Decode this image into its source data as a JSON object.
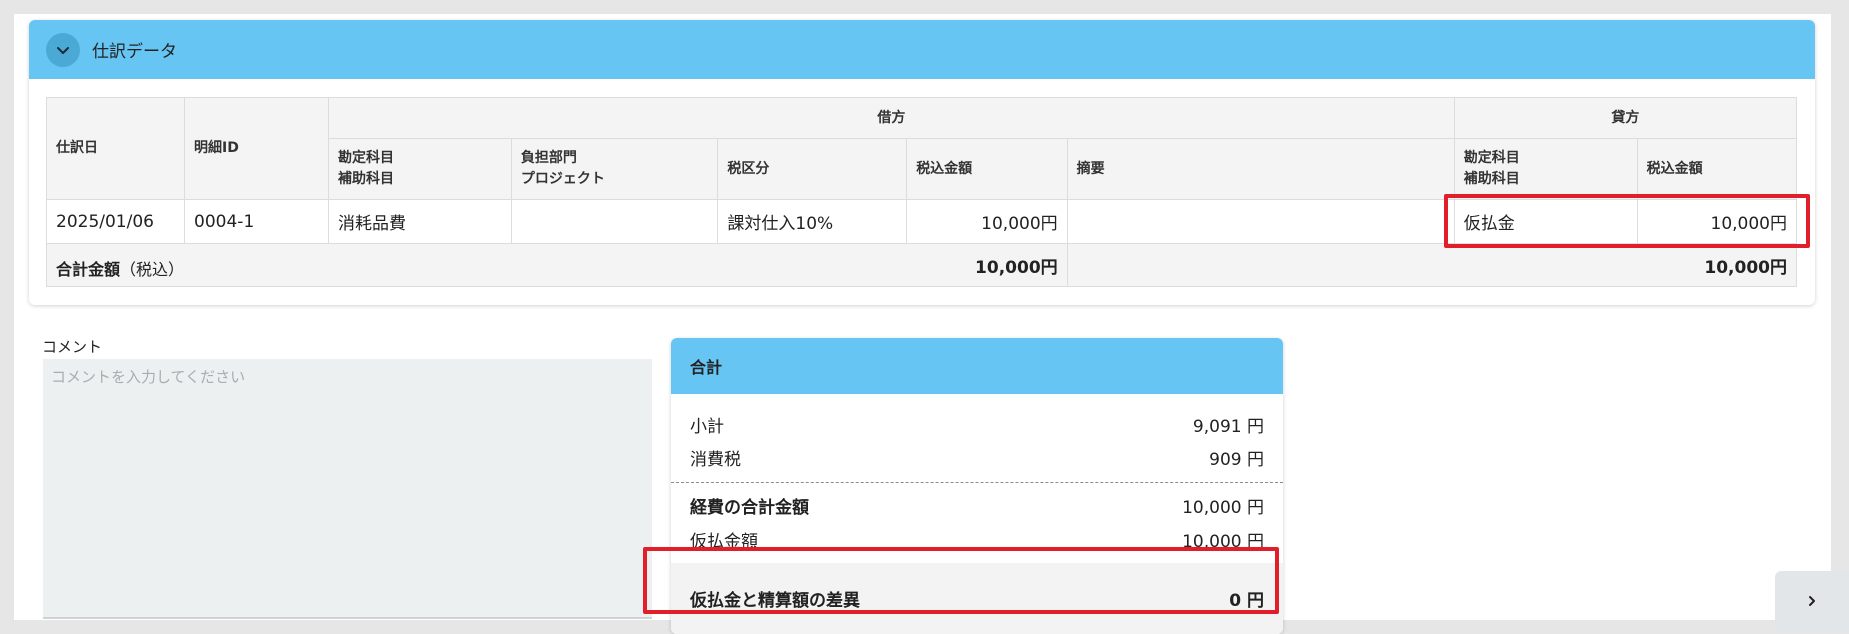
{
  "journal": {
    "title": "仕訳データ",
    "headers": {
      "date": "仕訳日",
      "detail_id": "明細ID",
      "debit": "借方",
      "credit": "貸方",
      "debit_account": "勘定科目",
      "debit_sub_account": "補助科目",
      "department": "負担部門",
      "project": "プロジェクト",
      "tax_category": "税区分",
      "debit_amount": "税込金額",
      "memo": "摘要",
      "credit_account": "勘定科目",
      "credit_sub_account": "補助科目",
      "credit_amount": "税込金額"
    },
    "rows": [
      {
        "date": "2025/01/06",
        "detail_id": "0004-1",
        "debit_account": "消耗品費",
        "department": "",
        "tax_category": "課対仕入10%",
        "debit_amount": "10,000円",
        "memo": "",
        "credit_account": "仮払金",
        "credit_amount": "10,000円"
      }
    ],
    "total": {
      "label": "合計金額",
      "label_suffix": "（税込）",
      "debit": "10,000円",
      "credit": "10,000円"
    }
  },
  "comment": {
    "label": "コメント",
    "placeholder": "コメントを入力してください",
    "value": ""
  },
  "totals": {
    "title": "合計",
    "subtotal_label": "小計",
    "subtotal_value": "9,091 円",
    "tax_label": "消費税",
    "tax_value": "909 円",
    "expense_total_label": "経費の合計金額",
    "expense_total_value": "10,000 円",
    "advance_label": "仮払金額",
    "advance_value": "10,000 円",
    "difference_label": "仮払金と精算額の差異",
    "difference_value": "0 円"
  },
  "icons": {
    "toggle": "chevron-down-icon",
    "next": "chevron-right-icon"
  },
  "colors": {
    "header": "#66c5f2",
    "highlight": "#e01f2b"
  }
}
